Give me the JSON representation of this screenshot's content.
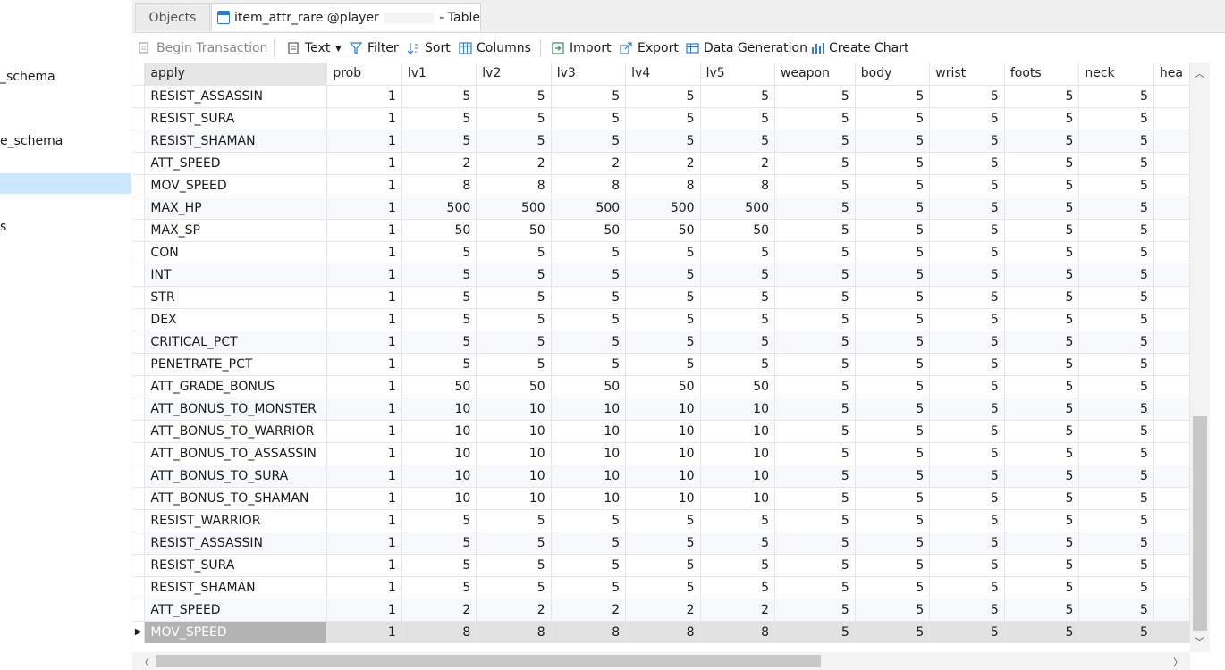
{
  "sidebar": {
    "items": [
      "_schema",
      "e_schema",
      "s"
    ]
  },
  "tabs": {
    "objects": "Objects",
    "table_name": "item_attr_rare @player",
    "table_suffix": "- Table"
  },
  "toolbar": {
    "begin_transaction": "Begin Transaction",
    "text": "Text",
    "filter": "Filter",
    "sort": "Sort",
    "columns": "Columns",
    "import": "Import",
    "export": "Export",
    "data_generation": "Data Generation",
    "create_chart": "Create Chart"
  },
  "grid": {
    "columns": [
      "apply",
      "prob",
      "lv1",
      "lv2",
      "lv3",
      "lv4",
      "lv5",
      "weapon",
      "body",
      "wrist",
      "foots",
      "neck",
      "hea"
    ],
    "rows": [
      [
        "RESIST_ASSASSIN",
        "1",
        "5",
        "5",
        "5",
        "5",
        "5",
        "5",
        "5",
        "5",
        "5",
        "5"
      ],
      [
        "RESIST_SURA",
        "1",
        "5",
        "5",
        "5",
        "5",
        "5",
        "5",
        "5",
        "5",
        "5",
        "5"
      ],
      [
        "RESIST_SHAMAN",
        "1",
        "5",
        "5",
        "5",
        "5",
        "5",
        "5",
        "5",
        "5",
        "5",
        "5"
      ],
      [
        "ATT_SPEED",
        "1",
        "2",
        "2",
        "2",
        "2",
        "2",
        "5",
        "5",
        "5",
        "5",
        "5"
      ],
      [
        "MOV_SPEED",
        "1",
        "8",
        "8",
        "8",
        "8",
        "8",
        "5",
        "5",
        "5",
        "5",
        "5"
      ],
      [
        "MAX_HP",
        "1",
        "500",
        "500",
        "500",
        "500",
        "500",
        "5",
        "5",
        "5",
        "5",
        "5"
      ],
      [
        "MAX_SP",
        "1",
        "50",
        "50",
        "50",
        "50",
        "50",
        "5",
        "5",
        "5",
        "5",
        "5"
      ],
      [
        "CON",
        "1",
        "5",
        "5",
        "5",
        "5",
        "5",
        "5",
        "5",
        "5",
        "5",
        "5"
      ],
      [
        "INT",
        "1",
        "5",
        "5",
        "5",
        "5",
        "5",
        "5",
        "5",
        "5",
        "5",
        "5"
      ],
      [
        "STR",
        "1",
        "5",
        "5",
        "5",
        "5",
        "5",
        "5",
        "5",
        "5",
        "5",
        "5"
      ],
      [
        "DEX",
        "1",
        "5",
        "5",
        "5",
        "5",
        "5",
        "5",
        "5",
        "5",
        "5",
        "5"
      ],
      [
        "CRITICAL_PCT",
        "1",
        "5",
        "5",
        "5",
        "5",
        "5",
        "5",
        "5",
        "5",
        "5",
        "5"
      ],
      [
        "PENETRATE_PCT",
        "1",
        "5",
        "5",
        "5",
        "5",
        "5",
        "5",
        "5",
        "5",
        "5",
        "5"
      ],
      [
        "ATT_GRADE_BONUS",
        "1",
        "50",
        "50",
        "50",
        "50",
        "50",
        "5",
        "5",
        "5",
        "5",
        "5"
      ],
      [
        "ATT_BONUS_TO_MONSTER",
        "1",
        "10",
        "10",
        "10",
        "10",
        "10",
        "5",
        "5",
        "5",
        "5",
        "5"
      ],
      [
        "ATT_BONUS_TO_WARRIOR",
        "1",
        "10",
        "10",
        "10",
        "10",
        "10",
        "5",
        "5",
        "5",
        "5",
        "5"
      ],
      [
        "ATT_BONUS_TO_ASSASSIN",
        "1",
        "10",
        "10",
        "10",
        "10",
        "10",
        "5",
        "5",
        "5",
        "5",
        "5"
      ],
      [
        "ATT_BONUS_TO_SURA",
        "1",
        "10",
        "10",
        "10",
        "10",
        "10",
        "5",
        "5",
        "5",
        "5",
        "5"
      ],
      [
        "ATT_BONUS_TO_SHAMAN",
        "1",
        "10",
        "10",
        "10",
        "10",
        "10",
        "5",
        "5",
        "5",
        "5",
        "5"
      ],
      [
        "RESIST_WARRIOR",
        "1",
        "5",
        "5",
        "5",
        "5",
        "5",
        "5",
        "5",
        "5",
        "5",
        "5"
      ],
      [
        "RESIST_ASSASSIN",
        "1",
        "5",
        "5",
        "5",
        "5",
        "5",
        "5",
        "5",
        "5",
        "5",
        "5"
      ],
      [
        "RESIST_SURA",
        "1",
        "5",
        "5",
        "5",
        "5",
        "5",
        "5",
        "5",
        "5",
        "5",
        "5"
      ],
      [
        "RESIST_SHAMAN",
        "1",
        "5",
        "5",
        "5",
        "5",
        "5",
        "5",
        "5",
        "5",
        "5",
        "5"
      ],
      [
        "ATT_SPEED",
        "1",
        "2",
        "2",
        "2",
        "2",
        "2",
        "5",
        "5",
        "5",
        "5",
        "5"
      ],
      [
        "MOV_SPEED",
        "1",
        "8",
        "8",
        "8",
        "8",
        "8",
        "5",
        "5",
        "5",
        "5",
        "5"
      ]
    ],
    "current_row": 24
  }
}
